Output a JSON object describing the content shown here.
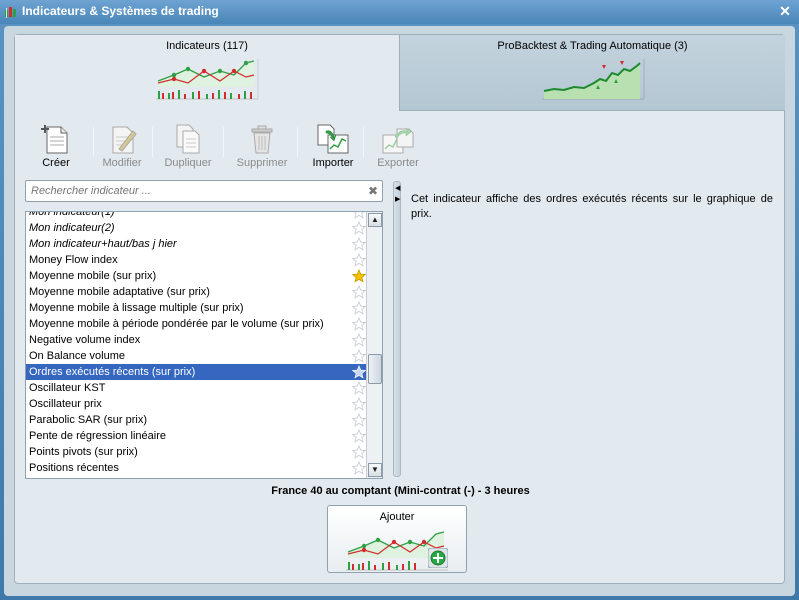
{
  "window": {
    "title": "Indicateurs & Systèmes de trading",
    "close_icon": "close-icon"
  },
  "tabs": [
    {
      "label": "Indicateurs (117)",
      "active": true
    },
    {
      "label": "ProBacktest & Trading Automatique (3)",
      "active": false
    }
  ],
  "toolbar": {
    "create": "Créer",
    "modify": "Modifier",
    "duplicate": "Dupliquer",
    "delete": "Supprimer",
    "import": "Importer",
    "export": "Exporter"
  },
  "search": {
    "placeholder": "Rechercher indicateur ...",
    "value": ""
  },
  "indicators": [
    {
      "label": "Mon indicateur(1)",
      "italic": true,
      "favorite": false
    },
    {
      "label": "Mon indicateur(2)",
      "italic": true,
      "favorite": false
    },
    {
      "label": "Mon indicateur+haut/bas j hier",
      "italic": true,
      "favorite": false
    },
    {
      "label": "Money Flow index",
      "italic": false,
      "favorite": false
    },
    {
      "label": "Moyenne mobile (sur prix)",
      "italic": false,
      "favorite": true
    },
    {
      "label": "Moyenne mobile adaptative (sur prix)",
      "italic": false,
      "favorite": false
    },
    {
      "label": "Moyenne mobile à lissage multiple (sur prix)",
      "italic": false,
      "favorite": false
    },
    {
      "label": "Moyenne mobile à période pondérée par le volume (sur prix)",
      "italic": false,
      "favorite": false
    },
    {
      "label": "Negative volume index",
      "italic": false,
      "favorite": false
    },
    {
      "label": "On Balance volume",
      "italic": false,
      "favorite": false
    },
    {
      "label": "Ordres exécutés récents (sur prix)",
      "italic": false,
      "favorite": false,
      "selected": true
    },
    {
      "label": "Oscillateur KST",
      "italic": false,
      "favorite": false
    },
    {
      "label": "Oscillateur prix",
      "italic": false,
      "favorite": false
    },
    {
      "label": "Parabolic SAR (sur prix)",
      "italic": false,
      "favorite": false
    },
    {
      "label": "Pente de régression linéaire",
      "italic": false,
      "favorite": false
    },
    {
      "label": "Points pivots (sur prix)",
      "italic": false,
      "favorite": false
    },
    {
      "label": "Positions récentes",
      "italic": false,
      "favorite": false
    }
  ],
  "description": "Cet indicateur affiche des ordres exécutés récents sur le graphique de prix.",
  "instrument": "France 40 au comptant (Mini-contrat  (-) - 3 heures",
  "add_button": "Ajouter",
  "colors": {
    "selection": "#3566c0",
    "star_favorite": "#f2c200",
    "chart_green": "#2ea043",
    "chart_red": "#d22d2d"
  }
}
